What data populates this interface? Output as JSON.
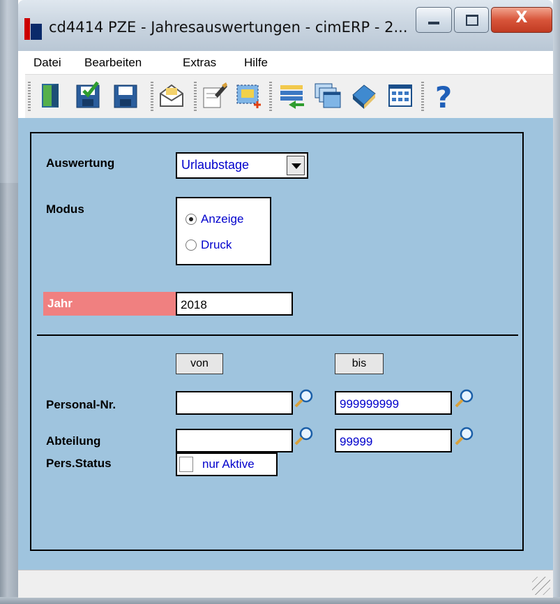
{
  "window": {
    "title": "cd4414 PZE - Jahresauswertungen - cimERP - 2...",
    "close_glyph": "X"
  },
  "menu": [
    "Datei",
    "Bearbeiten",
    "Extras",
    "Hilfe"
  ],
  "toolbar_icons": [
    "exit-door-icon",
    "save-check-icon",
    "save-icon",
    "mail-icon",
    "edit-note-icon",
    "new-record-icon",
    "import-list-icon",
    "windows-icon",
    "book-icon",
    "grid-icon",
    "help-icon"
  ],
  "form": {
    "auswertung_label": "Auswertung",
    "auswertung_value": "Urlaubstage",
    "modus_label": "Modus",
    "modus_options": [
      {
        "label": "Anzeige",
        "checked": true
      },
      {
        "label": "Druck",
        "checked": false
      }
    ],
    "jahr_label": "Jahr",
    "jahr_value": "2018",
    "von_label": "von",
    "bis_label": "bis",
    "personal_label": "Personal-Nr.",
    "personal_von": "",
    "personal_bis": "999999999",
    "abteilung_label": "Abteilung",
    "abteilung_von": "",
    "abteilung_bis": "99999",
    "status_label": "Pers.Status",
    "nur_aktive_label": "nur Aktive",
    "nur_aktive_checked": false
  },
  "colors": {
    "content_bg": "#9fc4de",
    "required_label_bg": "#f08080",
    "value_text": "#0000cc"
  }
}
